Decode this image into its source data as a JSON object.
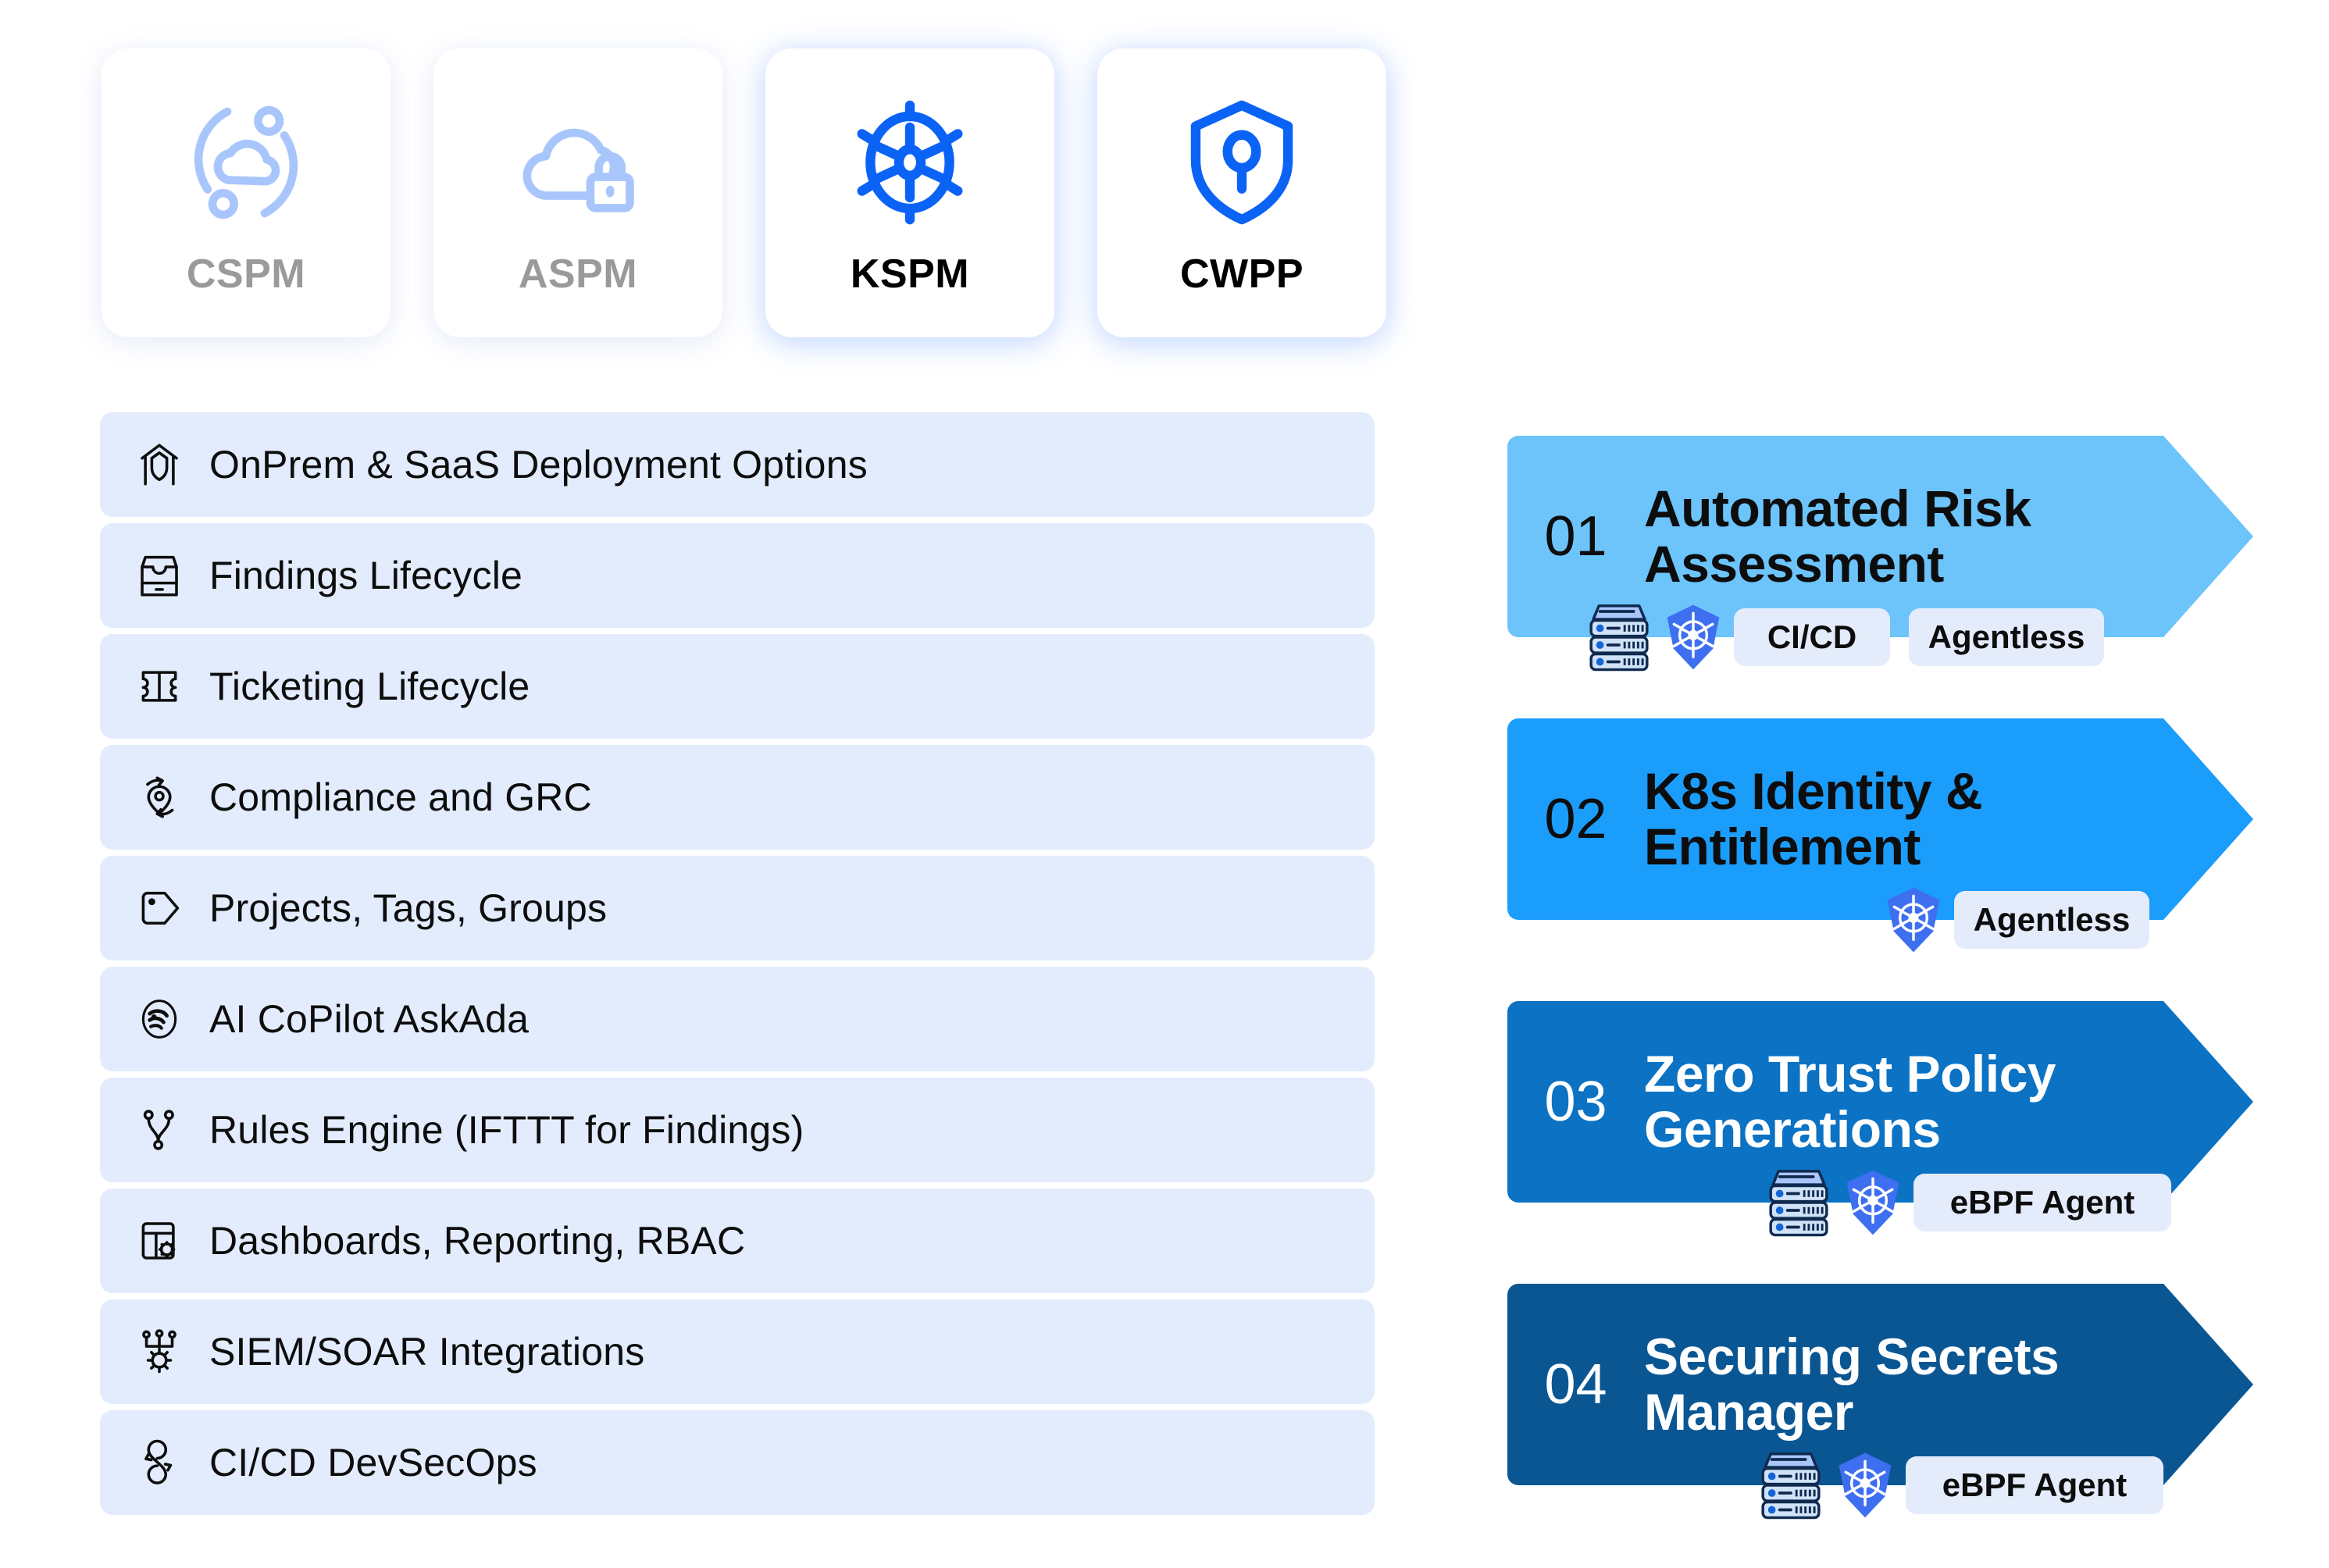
{
  "product_cards": [
    {
      "label": "CSPM",
      "icon": "cloud-orbit-icon",
      "state": "inactive"
    },
    {
      "label": "ASPM",
      "icon": "cloud-lock-icon",
      "state": "inactive"
    },
    {
      "label": "KSPM",
      "icon": "kubernetes-helm-icon",
      "state": "active"
    },
    {
      "label": "CWPP",
      "icon": "shield-key-icon",
      "state": "active"
    }
  ],
  "features": [
    {
      "label": "OnPrem & SaaS Deployment Options",
      "icon": "home-shield-icon"
    },
    {
      "label": "Findings Lifecycle",
      "icon": "inbox-tray-icon"
    },
    {
      "label": "Ticketing Lifecycle",
      "icon": "ticket-icon"
    },
    {
      "label": "Compliance and GRC",
      "icon": "compliance-refresh-icon"
    },
    {
      "label": "Projects, Tags, Groups",
      "icon": "tag-icon"
    },
    {
      "label": "AI CoPilot AskAda",
      "icon": "ai-copilot-icon"
    },
    {
      "label": "Rules Engine (IFTTT for Findings)",
      "icon": "branch-rules-icon"
    },
    {
      "label": "Dashboards, Reporting, RBAC",
      "icon": "dashboard-gear-icon"
    },
    {
      "label": "SIEM/SOAR Integrations",
      "icon": "integration-gear-icon"
    },
    {
      "label": "CI/CD DevSecOps",
      "icon": "cicd-loop-icon"
    }
  ],
  "pipeline": [
    {
      "number": "01",
      "title": "Automated Risk Assessment",
      "color": "#6cc4fb",
      "number_color": "#0d0d0d",
      "title_color": "#0d0d0d",
      "icons": [
        "server-stack-icon",
        "kubernetes-icon"
      ],
      "pills": [
        "CI/CD",
        "Agentless"
      ]
    },
    {
      "number": "02",
      "title": "K8s Identity & Entitlement",
      "color": "#1b9dfc",
      "number_color": "#0d0d0d",
      "title_color": "#0d0d0d",
      "icons": [
        "kubernetes-icon"
      ],
      "pills": [
        "Agentless"
      ]
    },
    {
      "number": "03",
      "title": "Zero Trust Policy Generations",
      "color": "#0b72c4",
      "number_color": "#ffffff",
      "title_color": "#ffffff",
      "icons": [
        "server-stack-icon",
        "kubernetes-icon"
      ],
      "pills": [
        "eBPF Agent"
      ]
    },
    {
      "number": "04",
      "title": "Securing Secrets Manager",
      "color": "#0a5693",
      "number_color": "#ffffff",
      "title_color": "#ffffff",
      "icons": [
        "server-stack-icon",
        "kubernetes-icon"
      ],
      "pills": [
        "eBPF Agent"
      ]
    }
  ],
  "colors": {
    "accent_blue": "#0b63f6",
    "muted_blue": "#a8c6fb",
    "row_bg": "#e3ecfd",
    "pill_bg": "#e4ecfb",
    "inactive_label": "#9a9a9a"
  }
}
